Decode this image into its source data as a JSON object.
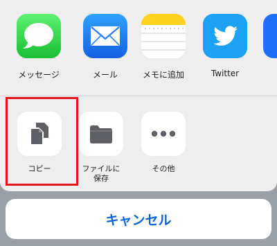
{
  "share_sheet": {
    "apps": [
      {
        "label": "メッセージ",
        "icon": "messages-icon",
        "color": "#34c759"
      },
      {
        "label": "メール",
        "icon": "mail-icon",
        "color": "#1d6ff5"
      },
      {
        "label": "メモに追加",
        "icon": "notes-icon",
        "color": "#ffd21f"
      },
      {
        "label": "Twitter",
        "icon": "twitter-icon",
        "color": "#1da1f2"
      }
    ],
    "actions": [
      {
        "label": "コピー",
        "icon": "copy-icon"
      },
      {
        "label": "ファイルに\n保存",
        "icon": "folder-icon"
      },
      {
        "label": "その他",
        "icon": "more-icon"
      }
    ]
  },
  "cancel_label": "キャンセル",
  "colors": {
    "highlight": "#e3151a",
    "accent": "#0a63d8"
  }
}
